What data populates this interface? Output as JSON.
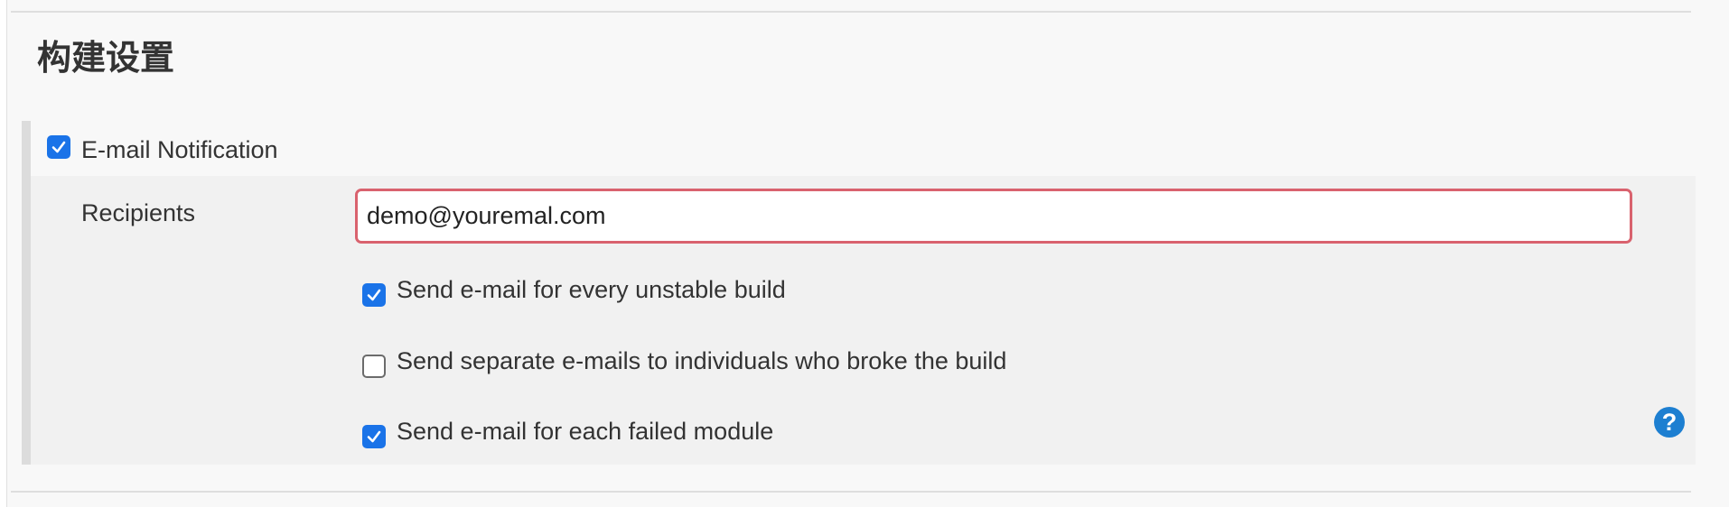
{
  "section": {
    "title": "构建设置"
  },
  "email_notification": {
    "label": "E-mail Notification",
    "checked": true
  },
  "recipients": {
    "label": "Recipients",
    "value": "demo@youremal.com"
  },
  "options": [
    {
      "label": "Send e-mail for every unstable build",
      "checked": true
    },
    {
      "label": "Send separate e-mails to individuals who broke the build",
      "checked": false
    },
    {
      "label": "Send e-mail for each failed module",
      "checked": true
    }
  ],
  "help": {
    "glyph": "?"
  },
  "colors": {
    "checkbox_checked": "#1a73e8",
    "input_error_border": "#d9626e",
    "help_icon": "#1d7fd1"
  }
}
